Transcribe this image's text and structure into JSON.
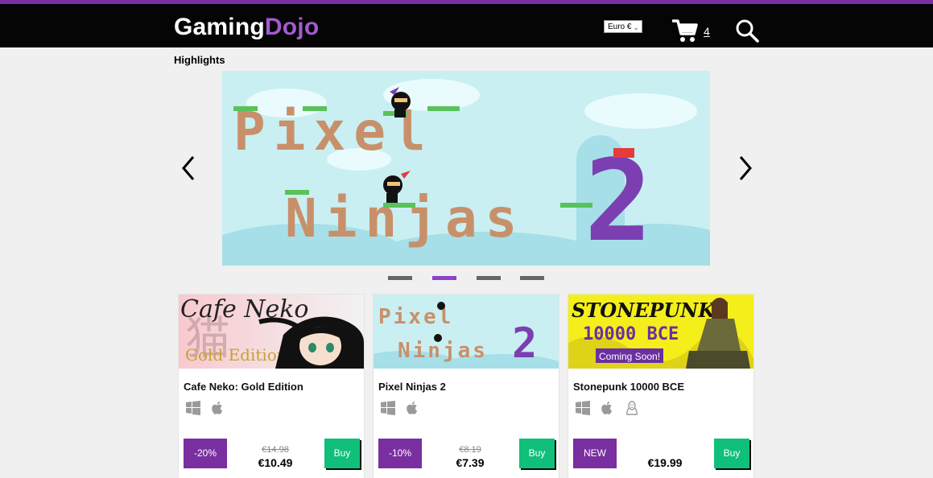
{
  "header": {
    "logo_part1": "Gaming",
    "logo_part2": "Dojo",
    "currency_label": "Euro €",
    "cart_count": "4"
  },
  "highlights": {
    "title": "Highlights",
    "active_slide": 2,
    "slide_count": 4,
    "banner_text_1": "Pixel",
    "banner_text_2": "Ninjas",
    "banner_number": "2"
  },
  "products": [
    {
      "name": "Cafe Neko: Gold Edition",
      "thumb_title": "Cafe Neko",
      "thumb_subtitle": "Gold Edition",
      "thumb_kanji": "猫",
      "platforms": [
        "windows-icon",
        "apple-icon"
      ],
      "badge": "-20%",
      "old_price": "€14.98",
      "price": "€10.49",
      "buy_label": "Buy"
    },
    {
      "name": "Pixel Ninjas 2",
      "thumb_title": "Pixel",
      "thumb_subtitle": "Ninjas",
      "thumb_number": "2",
      "platforms": [
        "windows-icon",
        "apple-icon"
      ],
      "badge": "-10%",
      "old_price": "€8.19",
      "price": "€7.39",
      "buy_label": "Buy"
    },
    {
      "name": "Stonepunk 10000 BCE",
      "thumb_title": "STONEPUNK",
      "thumb_subtitle": "10000 BCE",
      "thumb_note": "Coming Soon!",
      "platforms": [
        "windows-icon",
        "apple-icon",
        "linux-icon"
      ],
      "badge": "NEW",
      "price": "€19.99",
      "buy_label": "Buy"
    }
  ],
  "colors": {
    "brand_purple": "#7b2fa6",
    "buy_green": "#0fbf7a",
    "header_black": "#050505"
  }
}
